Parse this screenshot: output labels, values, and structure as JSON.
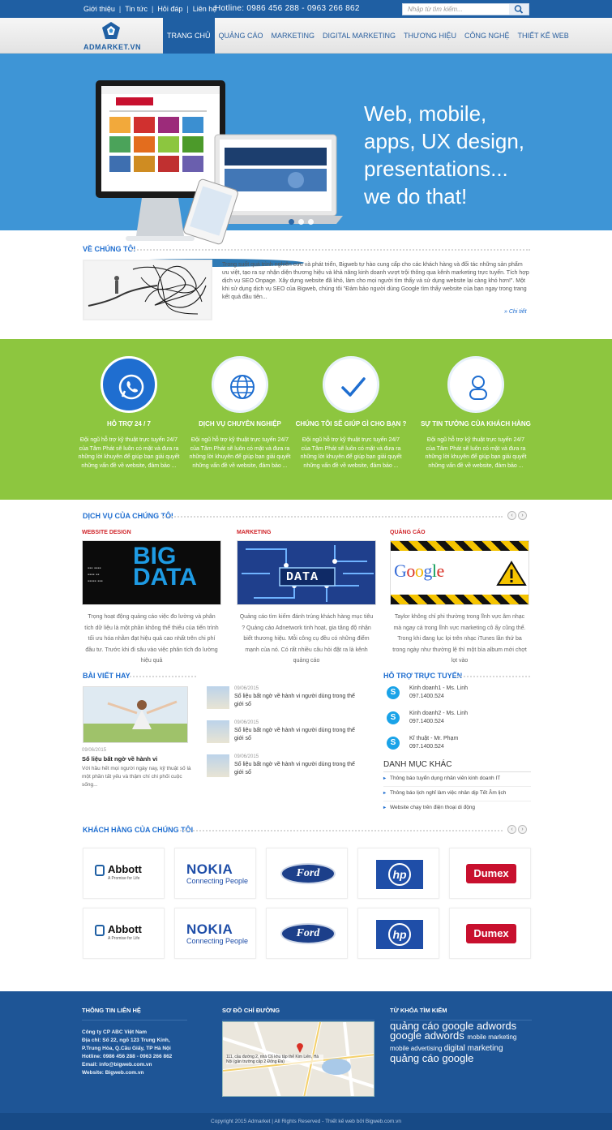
{
  "topbar": {
    "links": [
      "Giới thiệu",
      "Tin tức",
      "Hỏi đáp",
      "Liên hệ"
    ],
    "hotline": "Hotline:  0986 456 288 - 0963 266 862",
    "search_placeholder": "Nhập từ tìm kiếm..."
  },
  "brand": {
    "logo_text": "ADMARKET.VN"
  },
  "menu": [
    "TRANG CHỦ",
    "QUẢNG CÁO",
    "MARKETING",
    "DIGITAL MARKETING",
    "THƯƠNG HIỆU",
    "CÔNG NGHỆ",
    "THIẾT KẾ WEB"
  ],
  "hero": {
    "text": "Web, mobile,\napps, UX design,\npresentations...\nwe do that!",
    "slides": 3,
    "active_slide": 0
  },
  "about": {
    "title": "VỀ CHÚNG TÔI",
    "text": "Trong suốt quá trình nghiên cứu và phát triển, Bigweb tự hào cung cấp cho các khách hàng và đối tác những sản phẩm ưu việt, tạo ra sự nhận diện thương hiệu và khả năng kinh doanh vượt trội thông qua kênh marketing trực tuyến. Tích hợp dịch vụ SEO Onpage. Xây dựng website đã khó, làm cho mọi người tìm thấy và sử dụng website lại càng khó hơn!\". Một khi sử dụng dịch vụ SEO của Bigweb, chúng tôi \"Đảm bảo người dùng Google tìm thấy website của bạn ngay trong trang kết quả đầu tiên...",
    "more": "» Chi tiết"
  },
  "features": [
    {
      "title": "HỖ TRỢ 24 / 7",
      "text": "Đội ngũ hỗ trợ kỹ thuật trực tuyến 24/7 của Tâm Phát sẽ luôn có mặt và đưa ra những lời khuyên để giúp bạn giải quyết những vấn đề về website, đảm bảo ...",
      "icon": "phone-icon"
    },
    {
      "title": "DỊCH VỤ CHUYÊN NGHIỆP",
      "text": "Đội ngũ hỗ trợ kỹ thuật trực tuyến 24/7 của Tâm Phát sẽ luôn có mặt và đưa ra những lời khuyên để giúp bạn giải quyết những vấn đề về website, đảm bảo ...",
      "icon": "globe-icon"
    },
    {
      "title": "CHÚNG TÔI SẼ GIÚP GÌ CHO BẠN ?",
      "text": "Đội ngũ hỗ trợ kỹ thuật trực tuyến 24/7 của Tâm Phát sẽ luôn có mặt và đưa ra những lời khuyên để giúp bạn giải quyết những vấn đề về website, đảm bảo ...",
      "icon": "check-icon"
    },
    {
      "title": "SỰ TIN TƯỞNG CỦA KHÁCH HÀNG",
      "text": "Đội ngũ hỗ trợ kỹ thuật trực tuyến 24/7 của Tâm Phát sẽ luôn có mặt và đưa ra những lời khuyên để giúp bạn giải quyết những vấn đề về website, đảm bảo ...",
      "icon": "user-icon"
    }
  ],
  "services": {
    "title": "DỊCH VỤ CỦA CHÚNG TÔI",
    "items": [
      {
        "category": "WEBSITE DESIGN",
        "image_text": "BIG DATA",
        "text": "Trọng hoạt động quảng cáo việc đo lường và phân tích dữ liệu là một phần không thể thiếu của tiến trình tối ưu hóa nhằm đạt hiệu quả cao nhất trên chi phí đầu tư. Trước khi đi sâu vào việc phân tích đo lường hiệu quả"
      },
      {
        "category": "MARKETING",
        "image_text": "DATA",
        "text": "Quảng cáo tìm kiếm đánh trúng khách hàng mục tiêu ? Quảng cáo Adnetwork tinh hoạt, gia tăng độ nhận biết thương hiệu. Mỗi công cụ đều có những điểm mạnh của nó. Có rất nhiều câu hỏi đặt ra là kênh quảng cáo"
      },
      {
        "category": "QUẢNG CÁO",
        "image_text": "Google",
        "text": "Taylor không chỉ phi thường trong lĩnh vực âm nhạc mà ngay cả trong lĩnh vực marketing cô ấy cũng thế. Trong khi đang lục lọi trên nhạc iTunes lần thứ ba trong ngày như thường lệ thì một bìa album mới chợt lọt vào"
      }
    ]
  },
  "posts": {
    "title": "BÀI VIẾT HAY",
    "main": {
      "date": "09/06/2015",
      "title": "Số liệu bất ngờ về hành vi",
      "text": "Với hầu hết mọi người ngày nay, kỹ thuật số là một phần tất yếu và thậm chí chi phối cuộc sống..."
    },
    "list": [
      {
        "date": "09/06/2015",
        "title": "Số liệu bất ngờ về hành vi người dùng trong thế giới số"
      },
      {
        "date": "09/06/2015",
        "title": "Số liệu bất ngờ về hành vi người dùng trong thế giới số"
      },
      {
        "date": "09/06/2015",
        "title": "Số liệu bất ngờ về hành vi người dùng trong thế giới số"
      }
    ]
  },
  "support": {
    "title": "HỖ TRỢ TRỰC TUYẾN",
    "items": [
      {
        "name": "Kinh doanh1 - Ms. Linh",
        "phone": "097.1400.524"
      },
      {
        "name": "Kinh doanh2 - Ms. Linh",
        "phone": "097.1400.524"
      },
      {
        "name": "Kĩ thuật - Mr. Phạm",
        "phone": "097.1400.524"
      }
    ]
  },
  "categories": {
    "title": "DANH MỤC KHÁC",
    "items": [
      "Thông báo tuyển dụng nhân viên kinh doanh IT",
      "Thông báo lịch nghỉ làm việc nhân dịp Tết Âm lịch",
      "Website chạy trên điện thoại di động"
    ]
  },
  "clients": {
    "title": "KHÁCH HÀNG CỦA CHÚNG TÔI",
    "logos": [
      "Abbott",
      "NOKIA",
      "Ford",
      "hp",
      "Dumex",
      "Abbott",
      "NOKIA",
      "Ford",
      "hp",
      "Dumex"
    ],
    "abbott_tagline": "A Promise for Life",
    "nokia_tagline": "Connecting People"
  },
  "footer": {
    "contact_title": "THÔNG TIN LIÊN HỆ",
    "contact": [
      "Công ty CP ABC Việt Nam",
      "Địa chỉ: Số 22, ngõ 123 Trung Kính, P.Trung Hòa, Q.Cầu Giấy, TP Hà Nội",
      "Hotline: 0986 456 288 - 0963 266 862",
      "Email: info@bigweb.com.vn",
      "Website: Bigweb.com.vn"
    ],
    "map_title": "SƠ ĐỒ CHỈ ĐƯỜNG",
    "map_label": "111, cầu đường 2, nhà C6 khu tập thể Kim Liên, Hà Nội (gần trường cấp 2 Đống Đa)",
    "tags_title": "TỪ KHÓA TÌM KIẾM",
    "tags": [
      {
        "t": "quảng cáo",
        "s": 13
      },
      {
        "t": "google adwords",
        "s": 13
      },
      {
        "t": "google adwords",
        "s": 13
      },
      {
        "t": "mobile marketing",
        "s": 8
      },
      {
        "t": "mobile advertising",
        "s": 8
      },
      {
        "t": "digital marketing",
        "s": 10
      },
      {
        "t": "quảng",
        "s": 13
      },
      {
        "t": "cáo google",
        "s": 13
      }
    ],
    "copyright": "Copyright 2015 Admarket | All Rights Reserved - Thiết kế web bởi Bigweb.com.vn"
  },
  "colors": {
    "primary": "#1f5fa3",
    "hero": "#3e95d6",
    "green": "#8dc63f",
    "accent_red": "#d0262b",
    "link": "#1f6ed0"
  }
}
